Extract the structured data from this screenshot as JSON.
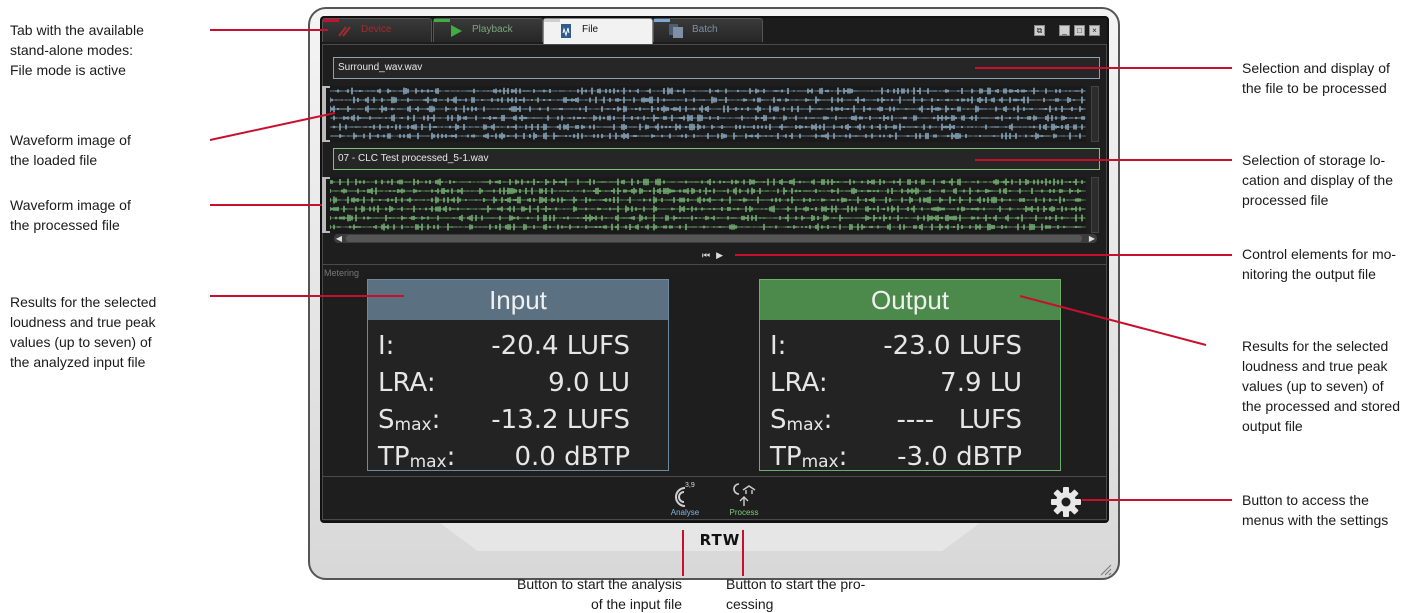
{
  "window": {
    "tabs": [
      {
        "label": "Device"
      },
      {
        "label": "Playback"
      },
      {
        "label": "File"
      },
      {
        "label": "Batch"
      }
    ],
    "active_tab": "File",
    "window_buttons": [
      "restore",
      "minimize",
      "maximize",
      "close"
    ],
    "logo": "RTW"
  },
  "files": {
    "input_name": "Surround_wav.wav",
    "output_name": "07 - CLC Test processed_5-1.wav"
  },
  "metering": {
    "label": "Metering",
    "input": {
      "title": "Input",
      "rows": [
        {
          "label": "I:",
          "sub": "",
          "value": "-20.4 LUFS"
        },
        {
          "label": "LRA:",
          "sub": "",
          "value": "9.0 LU"
        },
        {
          "label": "S",
          "sub": "max",
          "suffix": ":",
          "value": "-13.2 LUFS"
        },
        {
          "label": "TP",
          "sub": "max",
          "suffix": ":",
          "value": "0.0 dBTP"
        }
      ]
    },
    "output": {
      "title": "Output",
      "rows": [
        {
          "label": "I:",
          "sub": "",
          "value": "-23.0 LUFS"
        },
        {
          "label": "LRA:",
          "sub": "",
          "value": "7.9 LU"
        },
        {
          "label": "S",
          "sub": "max",
          "suffix": ":",
          "value": "----   LUFS"
        },
        {
          "label": "TP",
          "sub": "max",
          "suffix": ":",
          "value": "-3.0 dBTP"
        }
      ]
    }
  },
  "toolbar": {
    "analyse_label": "Analyse",
    "analyse_badge": "3,9",
    "process_label": "Process"
  },
  "callouts": {
    "tabs": [
      "Tab with the available",
      "stand-alone modes:",
      "File mode is active"
    ],
    "waveform_in": [
      "Waveform image of",
      "the loaded file"
    ],
    "waveform_out": [
      "Waveform image of",
      "the processed file"
    ],
    "results_in": [
      "Results for the selected",
      "loudness and true peak",
      "values (up to seven) of",
      "the analyzed input file"
    ],
    "file_select": [
      "Selection and display of",
      "the file to be processed"
    ],
    "storage_select": [
      "Selection of storage lo-",
      "cation and display of the",
      "processed file"
    ],
    "control_elements": [
      "Control elements for mo-",
      "nitoring the output file"
    ],
    "results_out": [
      "Results for the selected",
      "loudness and true peak",
      "values (up to seven) of",
      "the processed and stored",
      "output file"
    ],
    "settings": [
      "Button to access the",
      "menus with the settings"
    ],
    "analyse": [
      "Button to start the analysis",
      "of the input file"
    ],
    "process": [
      "Button to start the pro-",
      "cessing"
    ]
  },
  "colors": {
    "callout_line": "#c8102e",
    "input_accent": "#5b7080",
    "output_accent": "#4b8a4b",
    "wave_input": "#a9d2ec",
    "wave_output": "#8fe08f"
  }
}
